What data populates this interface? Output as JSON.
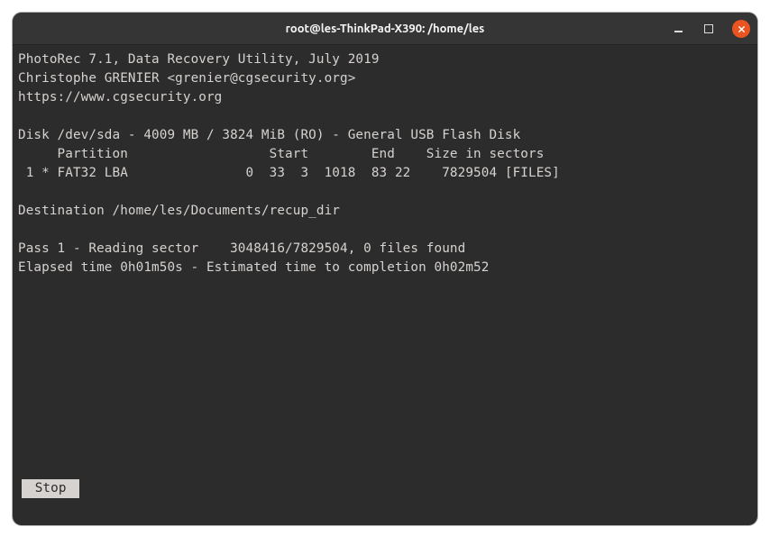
{
  "window": {
    "title": "root@les-ThinkPad-X390: /home/les"
  },
  "app": {
    "header_line1": "PhotoRec 7.1, Data Recovery Utility, July 2019",
    "header_line2": "Christophe GRENIER <grenier@cgsecurity.org>",
    "header_line3": "https://www.cgsecurity.org"
  },
  "disk": {
    "line": "Disk /dev/sda - 4009 MB / 3824 MiB (RO) - General USB Flash Disk",
    "header": "     Partition                  Start        End    Size in sectors",
    "row": " 1 * FAT32 LBA               0  33  3  1018  83 22    7829504 [FILES]"
  },
  "destination": "Destination /home/les/Documents/recup_dir",
  "pass": "Pass 1 - Reading sector    3048416/7829504, 0 files found",
  "time": "Elapsed time 0h01m50s - Estimated time to completion 0h02m52",
  "stop_label": " Stop "
}
